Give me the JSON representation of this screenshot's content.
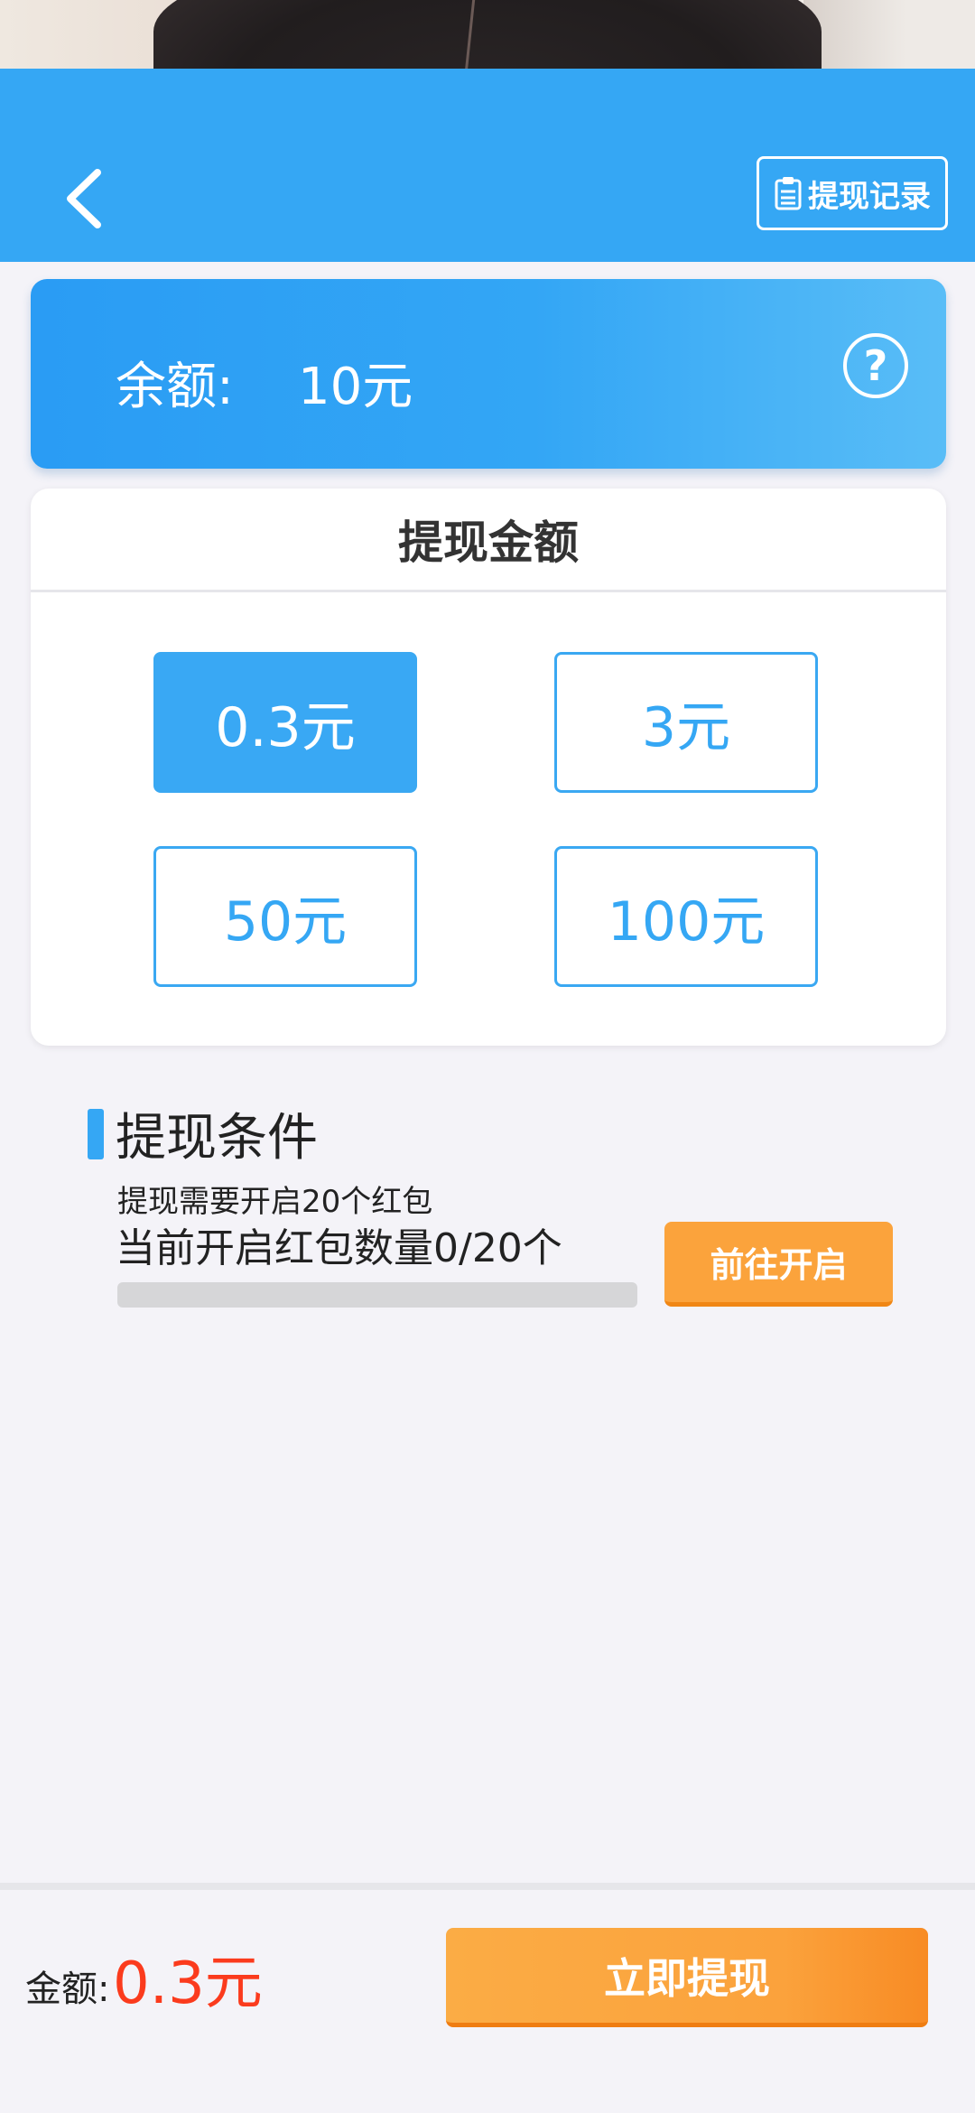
{
  "header": {
    "back_icon": "chevron-left-icon",
    "record_icon": "clipboard-icon",
    "record_label": "提现记录"
  },
  "balance": {
    "label": "余额:",
    "value": "10元",
    "help_label": "?"
  },
  "amount_section": {
    "title": "提现金额",
    "options": [
      {
        "label": "0.3元",
        "selected": true
      },
      {
        "label": "3元",
        "selected": false
      },
      {
        "label": "50元",
        "selected": false
      },
      {
        "label": "100元",
        "selected": false
      }
    ]
  },
  "conditions": {
    "title": "提现条件",
    "requirement": "提现需要开启20个红包",
    "progress_text": "当前开启红包数量0/20个",
    "progress_fraction": 0,
    "goto_label": "前往开启"
  },
  "footer": {
    "amount_label": "金额:",
    "amount_value": "0.3元",
    "withdraw_label": "立即提现"
  },
  "colors": {
    "primary_blue": "#35a7f4",
    "orange": "#fba33c",
    "price_red": "#fb3b1d",
    "background": "#f4f3f8"
  }
}
